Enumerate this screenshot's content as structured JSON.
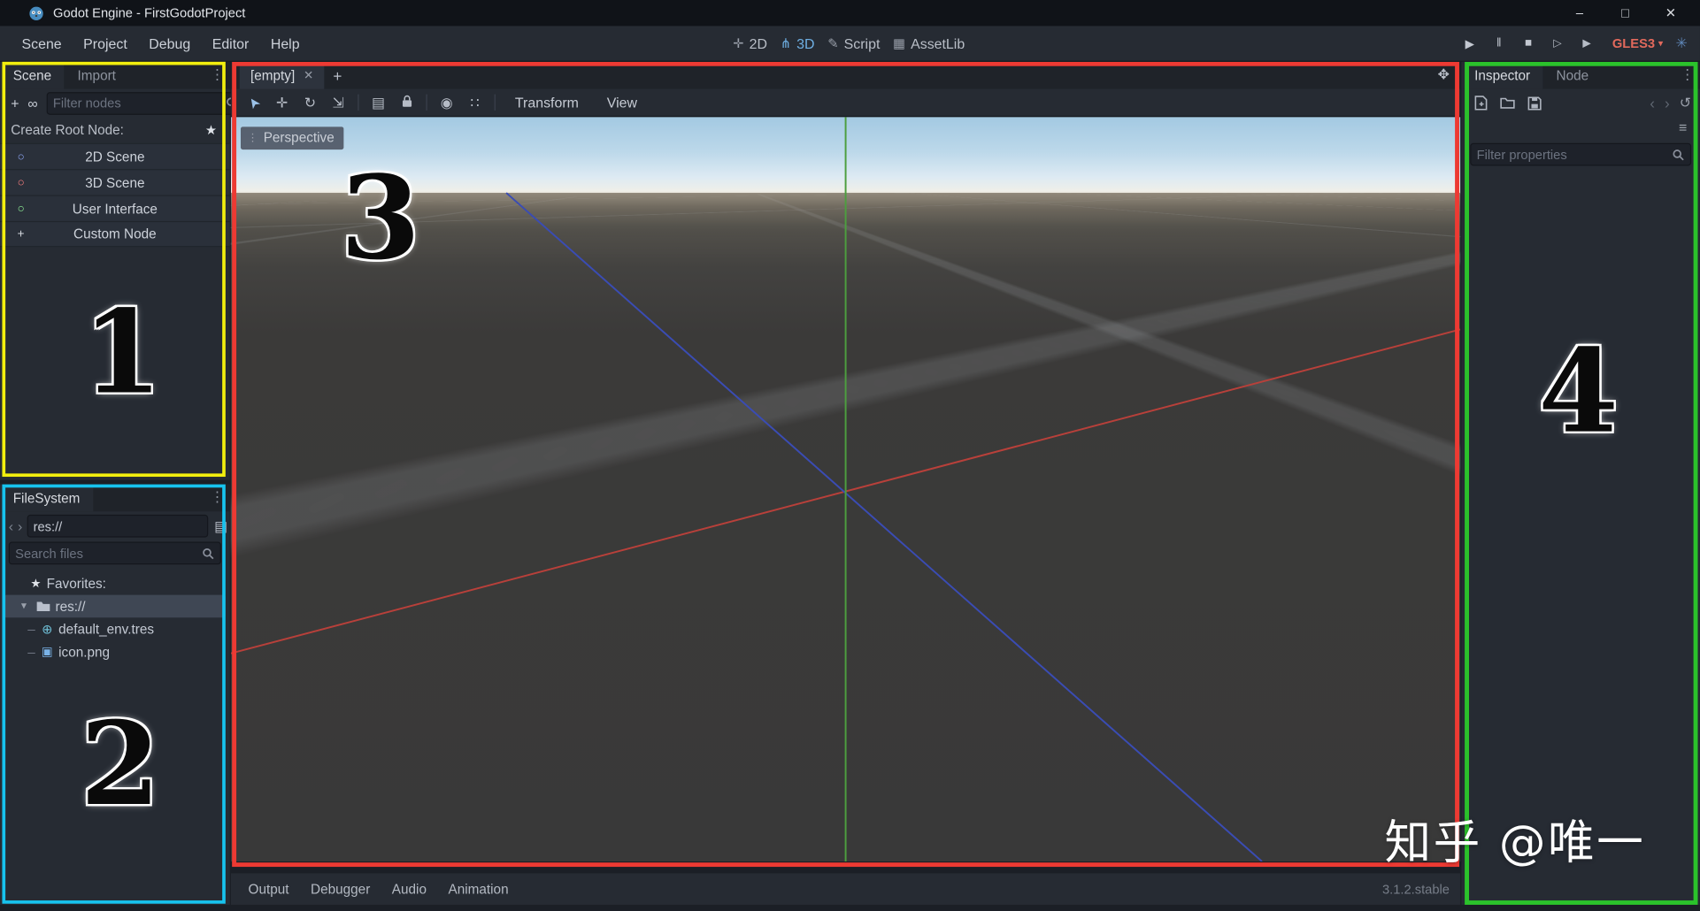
{
  "window": {
    "title": "Godot Engine - FirstGodotProject"
  },
  "menubar": {
    "items": [
      "Scene",
      "Project",
      "Debug",
      "Editor",
      "Help"
    ]
  },
  "workspaces": {
    "d2": "2D",
    "d3": "3D",
    "script": "Script",
    "assetlib": "AssetLib"
  },
  "runbar": {
    "renderer": "GLES3"
  },
  "scene_dock": {
    "tab_scene": "Scene",
    "tab_import": "Import",
    "filter_placeholder": "Filter nodes",
    "create_root_label": "Create Root Node:",
    "options": [
      {
        "label": "2D Scene"
      },
      {
        "label": "3D Scene"
      },
      {
        "label": "User Interface"
      },
      {
        "label": "Custom Node"
      }
    ]
  },
  "filesystem_dock": {
    "tab": "FileSystem",
    "path": "res://",
    "search_placeholder": "Search files",
    "favorites_label": "Favorites:",
    "root_label": "res://",
    "files": [
      {
        "label": "default_env.tres"
      },
      {
        "label": "icon.png"
      }
    ]
  },
  "scene_tabs": {
    "current": "[empty]"
  },
  "viewport": {
    "perspective_label": "Perspective",
    "transform_menu": "Transform",
    "view_menu": "View"
  },
  "bottom_bar": {
    "items": [
      "Output",
      "Debugger",
      "Audio",
      "Animation"
    ],
    "version": "3.1.2.stable"
  },
  "inspector_dock": {
    "tab_inspector": "Inspector",
    "tab_node": "Node",
    "filter_placeholder": "Filter properties"
  },
  "annotations": {
    "n1": "1",
    "n2": "2",
    "n3": "3",
    "n4": "4",
    "watermark": "知乎 @唯一"
  },
  "icons": {
    "minimize": "–",
    "maximize": "□",
    "close": "✕",
    "menu_dots": "⋮",
    "workspace_2d": "✛",
    "workspace_3d": "⋔",
    "script": "✎",
    "assetlib": "▦",
    "play": "▶",
    "pause": "‖",
    "stop": "■",
    "play_scene": "▷",
    "play_custom": "▶",
    "dropdown_caret": "▾",
    "spinner": "✳",
    "add": "+",
    "instance_link": "∞",
    "star": "★",
    "node_circle": "○",
    "back": "‹",
    "forward": "›",
    "grid_view": "▤",
    "caret_down": "▾",
    "tree_dash": "–",
    "globe": "⊕",
    "image": "▣",
    "tab_close": "✕",
    "tab_add": "+",
    "expand": "✥",
    "tool_select": "➤",
    "tool_move": "✛",
    "tool_rotate": "↻",
    "tool_scale": "⇲",
    "tool_list": "▤",
    "tool_local": "◉",
    "tool_snap": "∷",
    "history": "↺",
    "tools": "≡"
  },
  "colors": {
    "accent_blue": "#6fb0e4",
    "gles3_red": "#e2695c",
    "annotation_yellow": "#f2ee0e",
    "annotation_cyan": "#17c3ee",
    "annotation_red": "#ed3a33",
    "annotation_green": "#2bc22b",
    "axis_x_red": "#b8403a",
    "axis_y_green": "#4d9e3f",
    "axis_z_blue": "#3a4cb4",
    "node_2d_blue": "#8da5f3",
    "node_3d_red": "#fc7f7f",
    "node_ui_green": "#8eef97",
    "selected_row": "#3f4754"
  }
}
